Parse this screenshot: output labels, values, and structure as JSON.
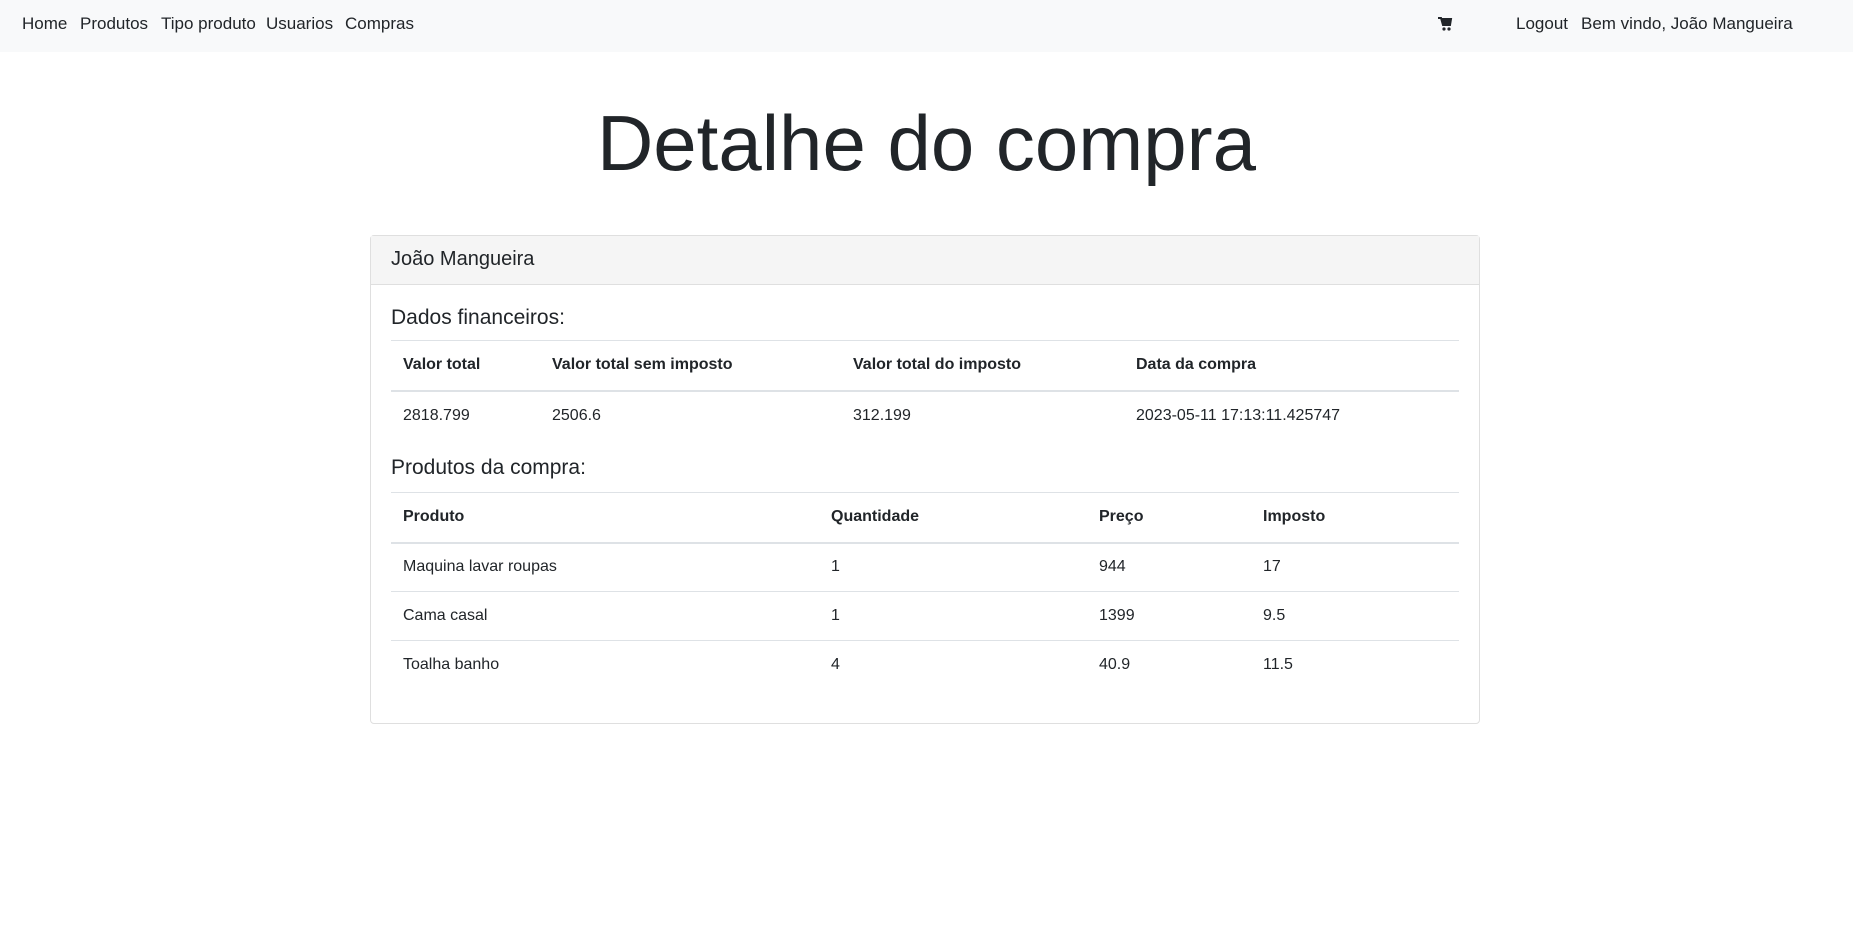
{
  "nav": {
    "links": [
      "Home",
      "Produtos",
      "Tipo produto",
      "Usuarios",
      "Compras"
    ],
    "cart_icon": "cart-icon",
    "logout": "Logout",
    "welcome": "Bem vindo, João Mangueira"
  },
  "page_title": "Detalhe do compra",
  "card": {
    "header": "João Mangueira",
    "financial": {
      "title": "Dados financeiros:",
      "columns": [
        "Valor total",
        "Valor total sem imposto",
        "Valor total do imposto",
        "Data da compra"
      ],
      "row": [
        "2818.799",
        "2506.6",
        "312.199",
        "2023-05-11 17:13:11.425747"
      ]
    },
    "products": {
      "title": "Produtos da compra:",
      "columns": [
        "Produto",
        "Quantidade",
        "Preço",
        "Imposto"
      ],
      "rows": [
        [
          "Maquina lavar roupas",
          "1",
          "944",
          "17"
        ],
        [
          "Cama casal",
          "1",
          "1399",
          "9.5"
        ],
        [
          "Toalha banho",
          "4",
          "40.9",
          "11.5"
        ]
      ]
    }
  }
}
